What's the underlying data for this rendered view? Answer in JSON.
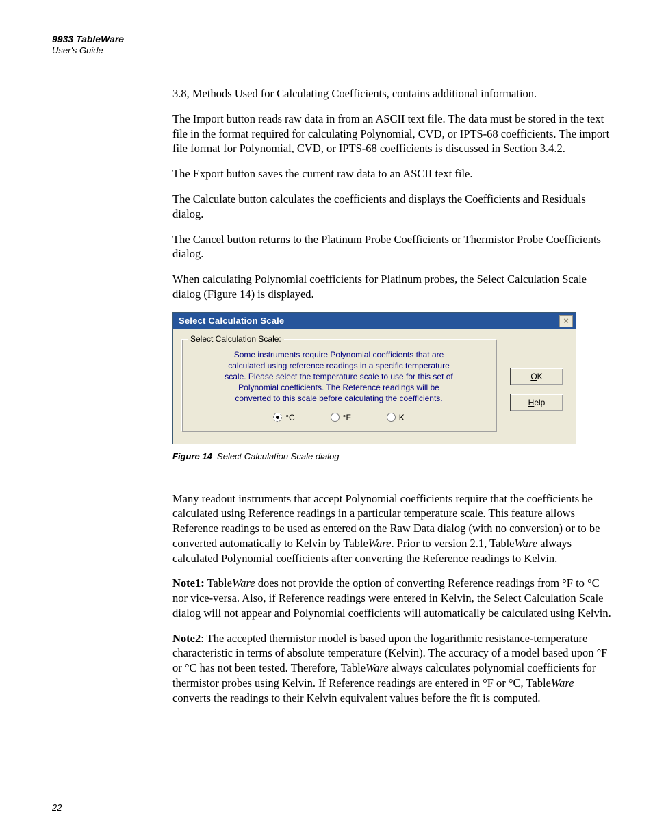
{
  "header": {
    "title": "9933 TableWare",
    "subtitle": "User's Guide"
  },
  "para": {
    "p1": "3.8, Methods Used for Calculating Coefficients, contains additional information.",
    "p2": "The Import button reads raw data in from an ASCII text file. The data must be stored in the text file in the format required for calculating Polynomial, CVD, or IPTS-68 coefficients. The import file format for Polynomial, CVD, or IPTS-68 coefficients is discussed in Section 3.4.2.",
    "p3": "The Export button saves the current raw data to an ASCII text file.",
    "p4": "The Calculate button calculates the coefficients and displays the Coefficients and Residuals dialog.",
    "p5": "The Cancel button returns to the Platinum Probe Coefficients or Thermistor Probe Coefficients dialog.",
    "p6": "When calculating Polynomial coefficients for Platinum probes, the Select Calculation Scale dialog (Figure 14) is displayed."
  },
  "dialog": {
    "title": "Select Calculation Scale",
    "close_glyph": "×",
    "legend": "Select Calculation Scale:",
    "instr_l1": "Some instruments require Polynomial coefficients that are",
    "instr_l2": "calculated using reference readings in a specific temperature",
    "instr_l3": "scale. Please select the temperature scale to use for this set of",
    "instr_l4": "Polynomial coefficients. The Reference readings will be",
    "instr_l5": "converted to this scale before calculating the coefficients.",
    "radio": {
      "c": "°C",
      "f": "°F",
      "k": "K"
    },
    "btn_ok_u": "O",
    "btn_ok_r": "K",
    "btn_help_u": "H",
    "btn_help_r": "elp"
  },
  "figure": {
    "label": "Figure 14",
    "caption": "Select Calculation Scale dialog"
  },
  "para2": {
    "p7a": "Many readout instruments that accept Polynomial coefficients require that the coefficients be calculated using Reference readings in a particular temperature scale. This feature allows Reference readings to be used as entered on the Raw Data dialog (with no conversion) or to be converted automatically to Kelvin by Table",
    "p7b": ". Prior to version 2.1, Table",
    "p7c": " always calculated Polynomial coefficients after converting the Reference readings to Kelvin.",
    "ware": "Ware",
    "n1_label": "Note1:",
    "n1a": " Table",
    "n1b": " does not provide the option of converting Reference readings from °F to °C nor vice-versa. Also, if Reference readings were entered in Kelvin, the Select Calculation Scale dialog will not appear and Polynomial coefficients will automatically be calculated using Kelvin.",
    "n2_label": "Note2",
    "n2a": ": The accepted thermistor model is based upon the logarithmic resistance-temperature characteristic in terms of absolute temperature (Kelvin). The accuracy of a model based upon °F or °C has not been tested. Therefore, Table",
    "n2b": " always calculates polynomial coefficients for thermistor probes using Kelvin. If Reference readings are entered in °F or °C, Table",
    "n2c": " converts the readings to their Kelvin equivalent values before the fit is computed."
  },
  "page_number": "22"
}
